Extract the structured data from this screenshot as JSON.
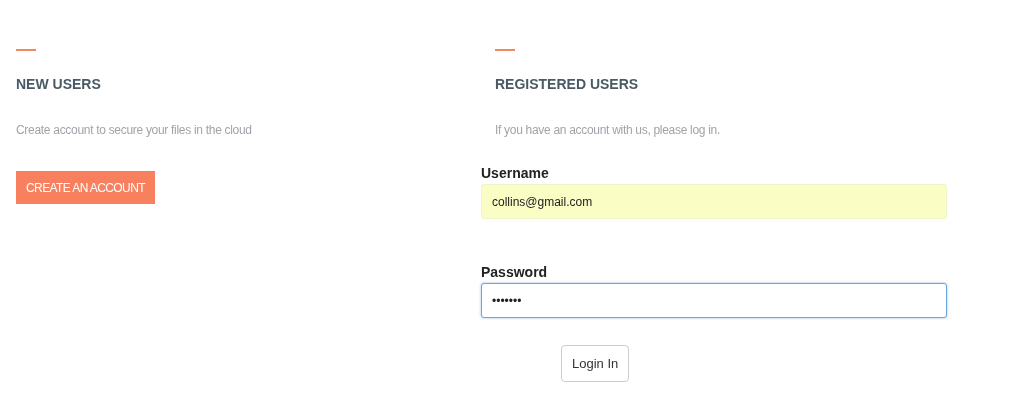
{
  "sections": [
    {
      "kind": "new",
      "heading": "NEW USERS",
      "text": "Create account to secure your files in the cloud",
      "button": "CREATE AN ACCOUNT"
    },
    {
      "kind": "login",
      "heading": "REGISTERED USERS",
      "text": "If you have an account with us, please log in.",
      "fields": [
        {
          "label": "Username",
          "value": "collins@gmail.com",
          "autofilled": true,
          "focused": false
        },
        {
          "label": "Password",
          "value": "•••••••",
          "autofilled": false,
          "focused": true
        }
      ],
      "button": "Login In"
    }
  ]
}
